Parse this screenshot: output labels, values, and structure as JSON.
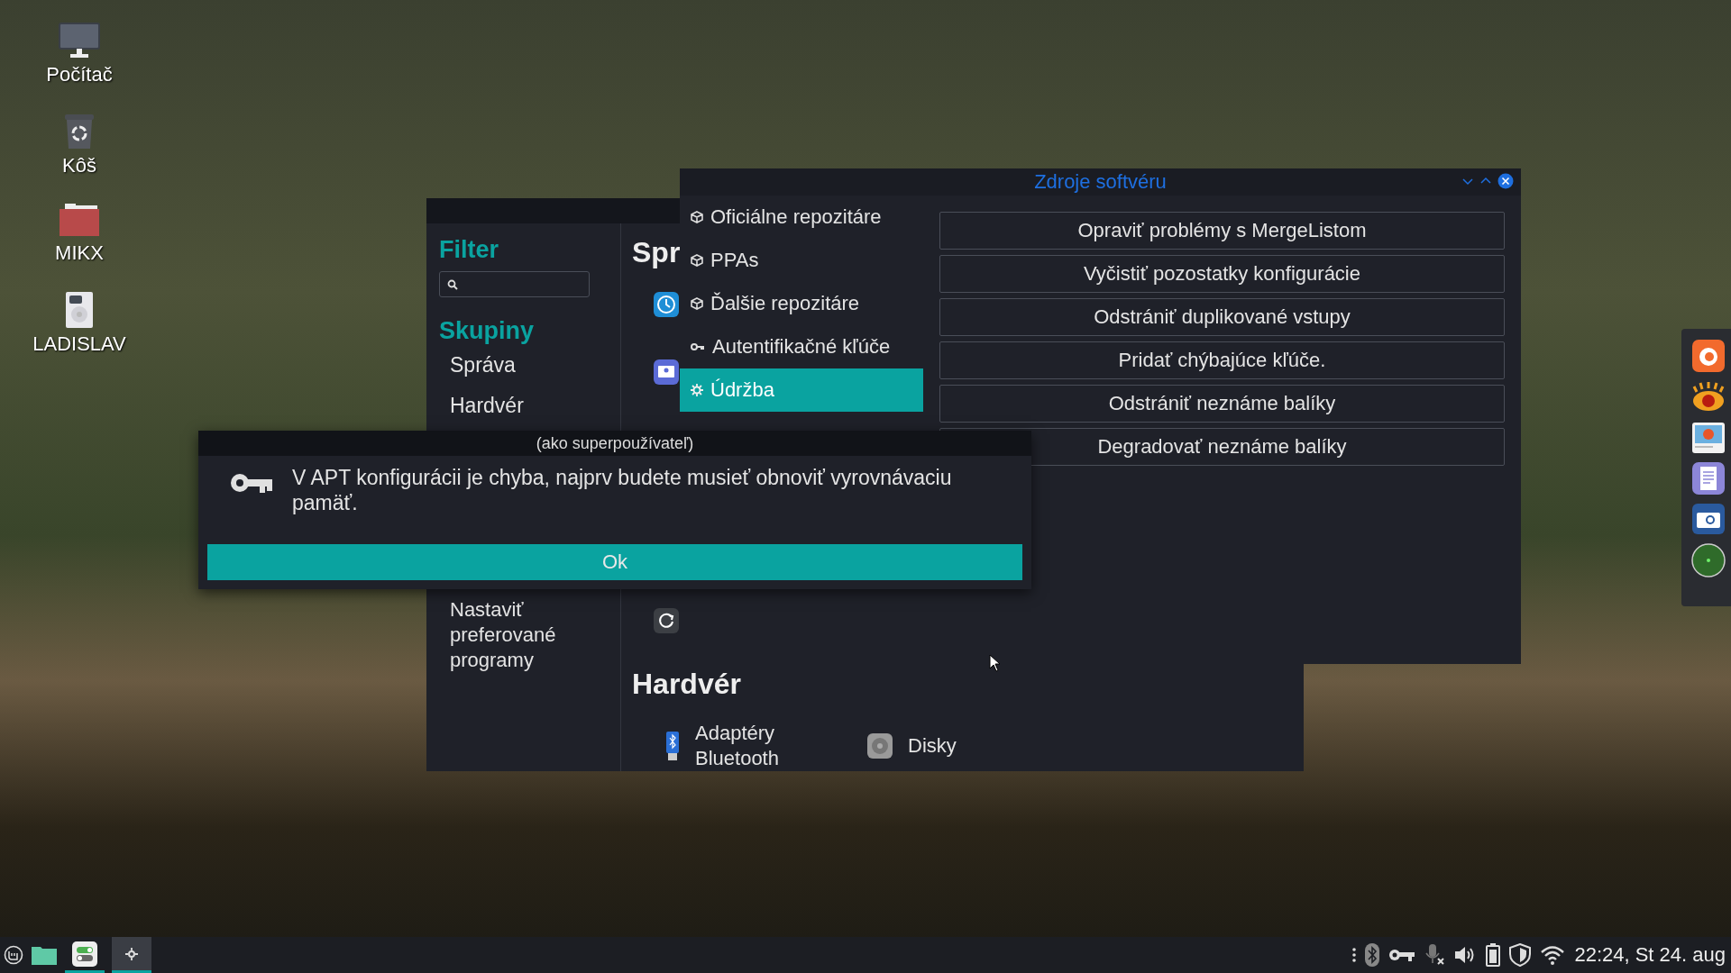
{
  "desktop_icons": [
    {
      "kind": "computer",
      "label": "Počítač"
    },
    {
      "kind": "trash",
      "label": "Kôš"
    },
    {
      "kind": "folder",
      "label": "MIKX"
    },
    {
      "kind": "drive",
      "label": "LADISLAV"
    }
  ],
  "settings_window": {
    "sidebar": {
      "filter_title": "Filter",
      "groups_title": "Skupiny",
      "groups": [
        "Správa",
        "Hardvér"
      ],
      "other_items": [
        "Nastaviť preferované programy"
      ]
    },
    "content": {
      "section_1_heading": "Spr",
      "section_2_heading": "Hardvér",
      "hardware_items": [
        {
          "kind": "bluetooth",
          "label": "Adaptéry Bluetooth"
        },
        {
          "kind": "disks",
          "label": "Disky"
        }
      ]
    }
  },
  "software_sources": {
    "title": "Zdroje softvéru",
    "sections": [
      {
        "kind": "repo",
        "label": "Oficiálne repozitáre",
        "selected": false
      },
      {
        "kind": "repo",
        "label": "PPAs",
        "selected": false
      },
      {
        "kind": "repo",
        "label": "Ďalšie repozitáre",
        "selected": false
      },
      {
        "kind": "key",
        "label": "Autentifikačné kľúče",
        "selected": false
      },
      {
        "kind": "maintenance",
        "label": "Údržba",
        "selected": true
      }
    ],
    "actions": [
      "Opraviť problémy s MergeListom",
      "Vyčistiť pozostatky konfigurácie",
      "Odstrániť duplikované vstupy",
      "Pridať chýbajúce kľúče.",
      "Odstrániť neznáme balíky",
      "Degradovať neznáme balíky"
    ]
  },
  "dialog": {
    "title": "(ako superpoužívateľ)",
    "message": "V APT konfigurácii je chyba, najprv budete musieť obnoviť vyrovnávaciu pamäť.",
    "button": "Ok"
  },
  "taskbar": {
    "clock": "22:24, St 24. aug"
  }
}
